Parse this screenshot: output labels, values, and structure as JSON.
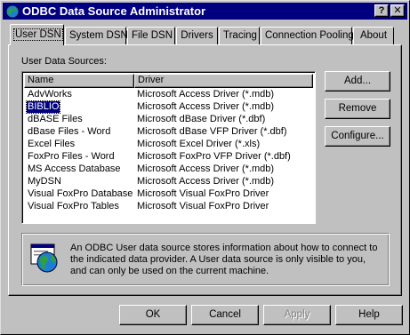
{
  "window": {
    "title": "ODBC Data Source Administrator",
    "help_button": "?",
    "close_button": "✕"
  },
  "tabs": [
    {
      "label": "User DSN",
      "active": true
    },
    {
      "label": "System DSN",
      "active": false
    },
    {
      "label": "File DSN",
      "active": false
    },
    {
      "label": "Drivers",
      "active": false
    },
    {
      "label": "Tracing",
      "active": false
    },
    {
      "label": "Connection Pooling",
      "active": false
    },
    {
      "label": "About",
      "active": false
    }
  ],
  "user_dsn": {
    "list_label": "User Data Sources:",
    "columns": [
      "Name",
      "Driver"
    ],
    "rows": [
      {
        "name": "AdvWorks",
        "driver": "Microsoft Access Driver (*.mdb)"
      },
      {
        "name": "BIBLIO",
        "driver": "Microsoft Access Driver (*.mdb)"
      },
      {
        "name": "dBASE Files",
        "driver": "Microsoft dBase Driver (*.dbf)"
      },
      {
        "name": "dBase Files - Word",
        "driver": "Microsoft dBase VFP Driver (*.dbf)"
      },
      {
        "name": "Excel Files",
        "driver": "Microsoft Excel Driver (*.xls)"
      },
      {
        "name": "FoxPro Files - Word",
        "driver": "Microsoft FoxPro VFP Driver (*.dbf)"
      },
      {
        "name": "MS Access Database",
        "driver": "Microsoft Access Driver (*.mdb)"
      },
      {
        "name": "MyDSN",
        "driver": "Microsoft Access Driver (*.mdb)"
      },
      {
        "name": "Visual FoxPro Database",
        "driver": "Microsoft Visual FoxPro Driver"
      },
      {
        "name": "Visual FoxPro Tables",
        "driver": "Microsoft Visual FoxPro Driver"
      }
    ],
    "selected_row": "BIBLIO",
    "buttons": {
      "add": "Add...",
      "remove": "Remove",
      "configure": "Configure..."
    },
    "info_text": "An ODBC User data source stores information about how to connect to\nthe indicated data provider.   A User data source is only visible to you,\nand can only be used on the current machine."
  },
  "dialog_buttons": {
    "ok": "OK",
    "cancel": "Cancel",
    "apply": "Apply",
    "help": "Help"
  },
  "colors": {
    "face": "#c0c0c0",
    "title_bar": "#000080",
    "selection": "#000080"
  }
}
